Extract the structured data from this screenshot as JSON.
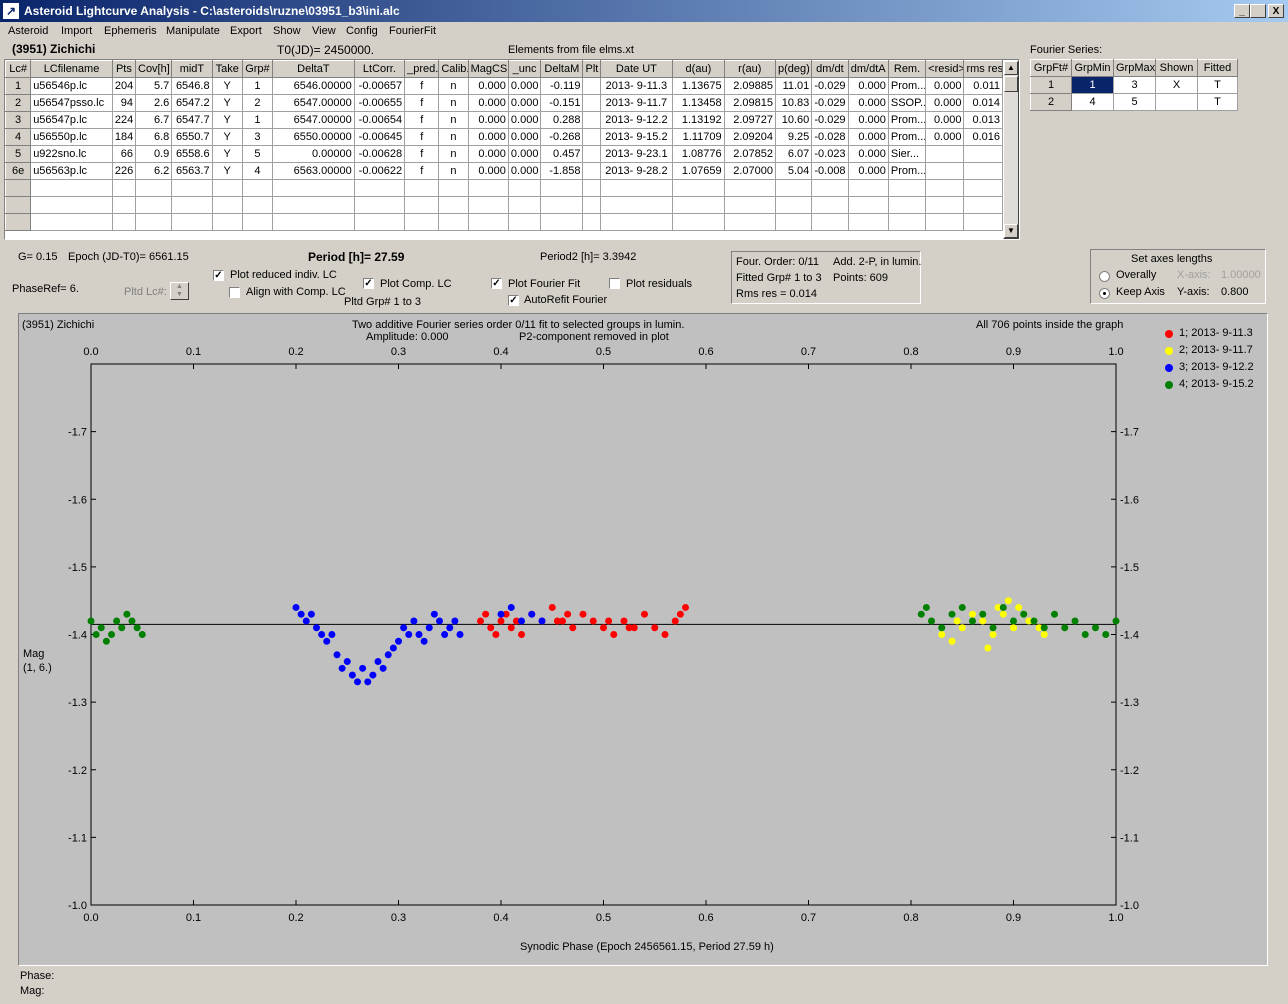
{
  "window": {
    "title": "Asteroid Lightcurve Analysis - C:\\asteroids\\ruzne\\03951_b3\\ini.alc",
    "min": "_",
    "max": " ",
    "close": "X"
  },
  "menu": [
    "Asteroid",
    "Import",
    "Ephemeris",
    "Manipulate",
    "Export",
    "Show",
    "View",
    "Config",
    "FourierFit"
  ],
  "header": {
    "asteroid": "(3951) Zichichi",
    "t0": "T0(JD)= 2450000.",
    "elements": "Elements from file elms.xt",
    "fourier_label": "Fourier Series:"
  },
  "lc_table": {
    "columns": [
      "Lc#",
      "LCfilename",
      "Pts",
      "Cov[h]",
      "midT",
      "Take",
      "Grp#",
      "DeltaT",
      "LtCorr.",
      "_pred.",
      "Calib.",
      "MagCS",
      "_unc",
      "DeltaM",
      "Plt",
      "Date UT",
      "d(au)",
      "r(au)",
      "p(deg)",
      "dm/dt",
      "dm/dtA",
      "Rem.",
      "<resid>",
      "rms res"
    ],
    "rows": [
      [
        "1",
        "u56546p.lc",
        "204",
        "5.7",
        "6546.8",
        "Y",
        "1",
        "6546.00000",
        "-0.00657",
        "f",
        "n",
        "0.000",
        "0.000",
        "-0.119",
        "",
        "2013- 9-11.3",
        "1.13675",
        "2.09885",
        "11.01",
        "-0.029",
        "0.000",
        "Prom...",
        "0.000",
        "0.011"
      ],
      [
        "2",
        "u56547psso.lc",
        "94",
        "2.6",
        "6547.2",
        "Y",
        "2",
        "6547.00000",
        "-0.00655",
        "f",
        "n",
        "0.000",
        "0.000",
        "-0.151",
        "",
        "2013- 9-11.7",
        "1.13458",
        "2.09815",
        "10.83",
        "-0.029",
        "0.000",
        "SSOP...",
        "0.000",
        "0.014"
      ],
      [
        "3",
        "u56547p.lc",
        "224",
        "6.7",
        "6547.7",
        "Y",
        "1",
        "6547.00000",
        "-0.00654",
        "f",
        "n",
        "0.000",
        "0.000",
        "0.288",
        "",
        "2013- 9-12.2",
        "1.13192",
        "2.09727",
        "10.60",
        "-0.029",
        "0.000",
        "Prom...",
        "0.000",
        "0.013"
      ],
      [
        "4",
        "u56550p.lc",
        "184",
        "6.8",
        "6550.7",
        "Y",
        "3",
        "6550.00000",
        "-0.00645",
        "f",
        "n",
        "0.000",
        "0.000",
        "-0.268",
        "",
        "2013- 9-15.2",
        "1.11709",
        "2.09204",
        "9.25",
        "-0.028",
        "0.000",
        "Prom...",
        "0.000",
        "0.016"
      ],
      [
        "5",
        "u922sno.lc",
        "66",
        "0.9",
        "6558.6",
        "Y",
        "5",
        "0.00000",
        "-0.00628",
        "f",
        "n",
        "0.000",
        "0.000",
        "0.457",
        "",
        "2013- 9-23.1",
        "1.08776",
        "2.07852",
        "6.07",
        "-0.023",
        "0.000",
        "Sier...",
        "",
        ""
      ],
      [
        "6e",
        "u56563p.lc",
        "226",
        "6.2",
        "6563.7",
        "Y",
        "4",
        "6563.00000",
        "-0.00622",
        "f",
        "n",
        "0.000",
        "0.000",
        "-1.858",
        "",
        "2013- 9-28.2",
        "1.07659",
        "2.07000",
        "5.04",
        "-0.008",
        "0.000",
        "Prom...",
        "",
        ""
      ]
    ]
  },
  "fourier_table": {
    "columns": [
      "GrpFt#",
      "GrpMin",
      "GrpMax",
      "Shown",
      "Fitted"
    ],
    "rows": [
      [
        "1",
        "1",
        "3",
        "X",
        "T"
      ],
      [
        "2",
        "4",
        "5",
        "",
        "T"
      ]
    ]
  },
  "controls": {
    "g": "G= 0.15",
    "epoch": "Epoch (JD-T0)= 6561.15",
    "period": "Period [h]= 27.59",
    "period2": "Period2 [h]= 3.3942",
    "phaseref": "PhaseRef= 6.",
    "pltd_lc": "Pltd Lc#:",
    "plot_reduced": "Plot reduced indiv. LC",
    "align_comp": "Align with Comp. LC",
    "plot_comp": "Plot Comp. LC",
    "pltd_grp": "Pltd Grp#  1   to   3",
    "plot_fourier": "Plot Fourier Fit",
    "autorefit": "AutoRefit Fourier",
    "plot_residuals": "Plot residuals",
    "four_order": "Four. Order:  0/11",
    "add2p": "Add. 2-P, in lumin.",
    "fitted_grp": "Fitted Grp# 1 to 3",
    "points": "Points: 609",
    "rms": "Rms res     = 0.014",
    "axes_title": "Set axes lengths",
    "overally": "Overally",
    "keep_axis": "Keep Axis",
    "xaxis_label": "X-axis:",
    "xaxis_val": "1.00000",
    "yaxis_label": "Y-axis:",
    "yaxis_val": "0.800",
    "check": "✓"
  },
  "plot_text": {
    "name": "(3951) Zichichi",
    "subtitle1": "Two additive Fourier series order 0/11 fit to selected groups in lumin.",
    "subtitle2": "Amplitude: 0.000",
    "subtitle3": "P2-component removed in plot",
    "inside": "All 706 points inside the graph",
    "ylabel1": "Mag",
    "ylabel2": "(1, 6.)",
    "xlabel": "Synodic Phase (Epoch 2456561.15, Period 27.59 h)"
  },
  "status": {
    "phase": "Phase:",
    "mag": "Mag:"
  },
  "chart_data": {
    "type": "scatter",
    "xlim": [
      0.0,
      1.0
    ],
    "ylim": [
      -1.8,
      -1.0
    ],
    "xticks": [
      0.0,
      0.1,
      0.2,
      0.3,
      0.4,
      0.5,
      0.6,
      0.7,
      0.8,
      0.9,
      1.0
    ],
    "yticks": [
      -1.7,
      -1.6,
      -1.5,
      -1.4,
      -1.3,
      -1.2,
      -1.1,
      -1.0
    ],
    "fit_line_y": -1.415,
    "series": [
      {
        "name": "1; 2013- 9-11.3",
        "color": "#ff0000",
        "x": [
          0.38,
          0.385,
          0.39,
          0.395,
          0.4,
          0.405,
          0.41,
          0.415,
          0.42,
          0.43,
          0.44,
          0.45,
          0.46,
          0.47,
          0.48,
          0.49,
          0.5,
          0.51,
          0.52,
          0.53,
          0.54,
          0.55,
          0.56,
          0.57,
          0.575,
          0.58,
          0.455,
          0.465,
          0.505,
          0.525
        ],
        "y": [
          -1.42,
          -1.43,
          -1.41,
          -1.4,
          -1.42,
          -1.43,
          -1.41,
          -1.42,
          -1.4,
          -1.43,
          -1.42,
          -1.44,
          -1.42,
          -1.41,
          -1.43,
          -1.42,
          -1.41,
          -1.4,
          -1.42,
          -1.41,
          -1.43,
          -1.41,
          -1.4,
          -1.42,
          -1.43,
          -1.44,
          -1.42,
          -1.43,
          -1.42,
          -1.41
        ]
      },
      {
        "name": "2; 2013- 9-11.7",
        "color": "#ffff00",
        "x": [
          0.83,
          0.84,
          0.845,
          0.85,
          0.86,
          0.87,
          0.88,
          0.885,
          0.89,
          0.9,
          0.905,
          0.91,
          0.92,
          0.925,
          0.93,
          0.875,
          0.895,
          0.915
        ],
        "y": [
          -1.4,
          -1.39,
          -1.42,
          -1.41,
          -1.43,
          -1.42,
          -1.4,
          -1.44,
          -1.43,
          -1.41,
          -1.44,
          -1.43,
          -1.42,
          -1.41,
          -1.4,
          -1.38,
          -1.45,
          -1.42
        ]
      },
      {
        "name": "3; 2013- 9-12.2",
        "color": "#0000ff",
        "x": [
          0.2,
          0.205,
          0.21,
          0.215,
          0.22,
          0.225,
          0.23,
          0.235,
          0.24,
          0.245,
          0.25,
          0.255,
          0.26,
          0.265,
          0.27,
          0.275,
          0.28,
          0.285,
          0.29,
          0.295,
          0.3,
          0.305,
          0.31,
          0.315,
          0.32,
          0.325,
          0.33,
          0.335,
          0.34,
          0.345,
          0.35,
          0.355,
          0.36,
          0.4,
          0.41,
          0.42,
          0.43,
          0.44
        ],
        "y": [
          -1.44,
          -1.43,
          -1.42,
          -1.43,
          -1.41,
          -1.4,
          -1.39,
          -1.4,
          -1.37,
          -1.35,
          -1.36,
          -1.34,
          -1.33,
          -1.35,
          -1.33,
          -1.34,
          -1.36,
          -1.35,
          -1.37,
          -1.38,
          -1.39,
          -1.41,
          -1.4,
          -1.42,
          -1.4,
          -1.39,
          -1.41,
          -1.43,
          -1.42,
          -1.4,
          -1.41,
          -1.42,
          -1.4,
          -1.43,
          -1.44,
          -1.42,
          -1.43,
          -1.42
        ]
      },
      {
        "name": "4; 2013- 9-15.2",
        "color": "#008000",
        "x": [
          0.0,
          0.005,
          0.01,
          0.015,
          0.02,
          0.025,
          0.03,
          0.035,
          0.04,
          0.045,
          0.05,
          0.81,
          0.815,
          0.82,
          0.83,
          0.84,
          0.85,
          0.86,
          0.87,
          0.88,
          0.89,
          0.9,
          0.91,
          0.92,
          0.93,
          0.94,
          0.95,
          0.96,
          0.97,
          0.98,
          0.99,
          1.0
        ],
        "y": [
          -1.42,
          -1.4,
          -1.41,
          -1.39,
          -1.4,
          -1.42,
          -1.41,
          -1.43,
          -1.42,
          -1.41,
          -1.4,
          -1.43,
          -1.44,
          -1.42,
          -1.41,
          -1.43,
          -1.44,
          -1.42,
          -1.43,
          -1.41,
          -1.44,
          -1.42,
          -1.43,
          -1.42,
          -1.41,
          -1.43,
          -1.41,
          -1.42,
          -1.4,
          -1.41,
          -1.4,
          -1.42
        ]
      }
    ]
  }
}
